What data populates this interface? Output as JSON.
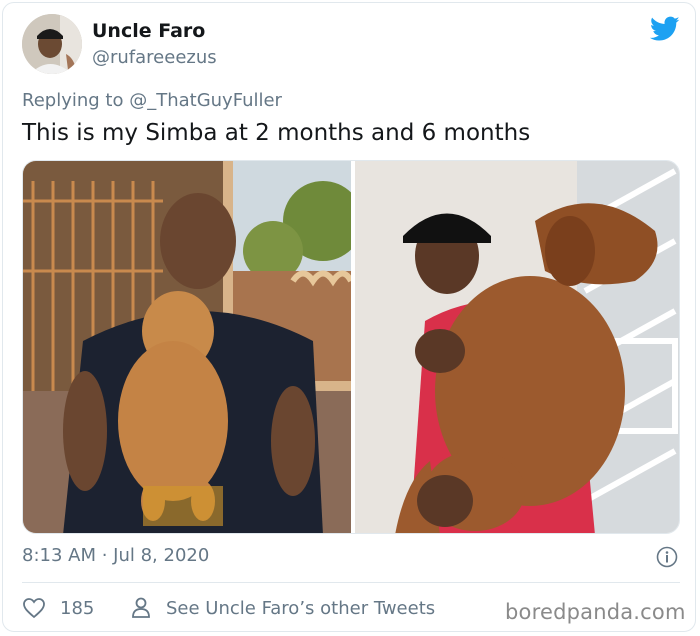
{
  "tweet": {
    "display_name": "Uncle Faro",
    "handle": "@rufareeezus",
    "replying_prefix": "Replying to ",
    "replying_to": "@_ThatGuyFuller",
    "text": "This is my Simba at 2 months and 6 months",
    "timestamp": "8:13 AM · Jul 8, 2020",
    "like_count": "185",
    "other_tweets_label": "See Uncle Faro’s other Tweets"
  },
  "watermark": "boredpanda.com",
  "colors": {
    "twitter_blue": "#1da1f2",
    "secondary_text": "#657786",
    "primary_text": "#14171a",
    "border": "#e1e8ed"
  },
  "icons": {
    "brand": "twitter-bird-icon",
    "info": "info-icon",
    "like": "heart-icon",
    "profile": "person-icon"
  }
}
